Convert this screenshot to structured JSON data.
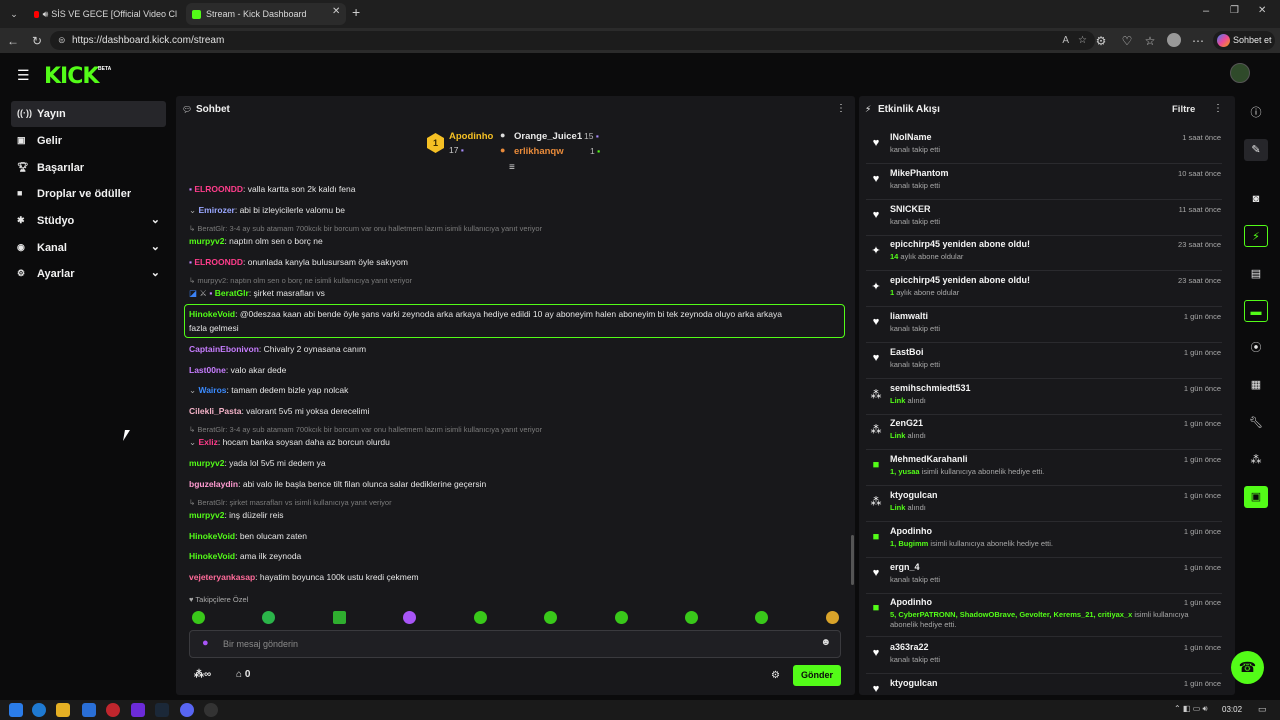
{
  "browser": {
    "tabs": [
      {
        "label": "SİS VE GECE [Official Video Cl"
      },
      {
        "label": "Stream - Kick Dashboard"
      }
    ],
    "url": "https://dashboard.kick.com/stream",
    "copilot": "Sohbet et"
  },
  "logo": {
    "text": "KICK",
    "badge": "BETA"
  },
  "sidebar": {
    "items": [
      {
        "label": "Yayın",
        "icon": "broadcast-icon"
      },
      {
        "label": "Gelir",
        "icon": "revenue-icon"
      },
      {
        "label": "Başarılar",
        "icon": "trophy-icon"
      },
      {
        "label": "Droplar ve ödüller",
        "icon": "gift-icon"
      },
      {
        "label": "Stüdyo",
        "icon": "studio-icon"
      },
      {
        "label": "Kanal",
        "icon": "channel-icon"
      },
      {
        "label": "Ayarlar",
        "icon": "gear-icon"
      }
    ]
  },
  "chat": {
    "title": "Sohbet",
    "leaderboard": {
      "first": {
        "rank": "1",
        "name": "Apodinho",
        "count": "17"
      },
      "second": {
        "name": "Orange_Juice1",
        "count": "15"
      },
      "third": {
        "name": "erlikhanqw",
        "count": "1"
      }
    },
    "messages": [
      {
        "user": "ELROONDD",
        "text": ": valla kartta son 2k kaldı fena",
        "color": "#ff3d8b"
      },
      {
        "user": "Emirozer",
        "text": ": abi bi izleyicilerle valomu be",
        "color": "#9aa7ff"
      },
      {
        "reply": "BeratGlr: 3-4 ay sub atamam 700kcık bir borcum var onu halletmem lazım isimli kullanıcıya yanıt veriyor"
      },
      {
        "user": "murpyv2",
        "text": ": naptın olm sen o borç ne",
        "color": "#53fc18"
      },
      {
        "user": "ELROONDD",
        "text": ": onunlada kanyla bulusursam öyle sakıyom",
        "color": "#ff3d8b"
      },
      {
        "reply": "murpyv2: naptın olm sen o borç ne isimli kullanıcıya yanıt veriyor"
      },
      {
        "user": "BeratGlr",
        "text": ": şirket masrafları vs",
        "color": "#53fc18"
      },
      {
        "user": "HinokeVoid",
        "text": ": @0deszaa kaan abi bende öyle şans varki zeynoda arka arkaya hediye edildi 10 ay aboneyim halen aboneyim bi tek zeynoda oluyo arka arkaya",
        "text2": "fazla gelmesi",
        "color": "#53fc18"
      },
      {
        "user": "CaptainEbonivon",
        "text": ": Chivalry 2 oynasana canım",
        "color": "#c77dff"
      },
      {
        "user": "Last00ne",
        "text": ": valo akar dede",
        "color": "#c77dff"
      },
      {
        "user": "Wairos",
        "text": ": tamam dedem bizle yap nolcak",
        "color": "#3b8bff"
      },
      {
        "user": "Cilekli_Pasta",
        "text": ": valorant 5v5 mi yoksa derecelimi",
        "color": "#f5b3c8"
      },
      {
        "reply": "BeratGlr: 3-4 ay sub atamam 700kcık bir borcum var onu halletmem lazım isimli kullanıcıya yanıt veriyor"
      },
      {
        "user": "Exliz",
        "text": ": hocam banka soysan daha az borcun olurdu",
        "color": "#ff3d8b"
      },
      {
        "user": "murpyv2",
        "text": ": yada lol 5v5 mi dedem ya",
        "color": "#53fc18"
      },
      {
        "user": "bguzelaydin",
        "text": ": abi valo ile başla bence tilt filan olunca salar dediklerine geçersin",
        "color": "#ff9bd1"
      },
      {
        "reply": "BeratGlr: şirket masrafları vs isimli kullanıcıya yanıt veriyor"
      },
      {
        "user": "murpyv2",
        "text": ": inş düzelir reis",
        "color": "#53fc18"
      },
      {
        "user": "HinokeVoid",
        "text": ": ben olucam zaten",
        "color": "#53fc18"
      },
      {
        "user": "HinokeVoid",
        "text": ": ama ilk zeynoda",
        "color": "#53fc18"
      },
      {
        "user": "vejeteryankasap",
        "text": ": hayatim boyunca 100k ustu kredi çekmem",
        "color": "#ff6b9a"
      }
    ],
    "emote_tab": "Takipçilere Özel",
    "input_placeholder": "Bir mesaj gönderin",
    "points": "∞",
    "shop_count": "0",
    "send": "Gönder"
  },
  "activity": {
    "title": "Etkinlik Akışı",
    "filter": "Filtre",
    "events": [
      {
        "name": "INolName",
        "desc": "kanalı takip etti",
        "time": "1 saat önce",
        "icon": "heart-icon"
      },
      {
        "name": "MikePhantom",
        "desc": "kanalı takip etti",
        "time": "10 saat önce",
        "icon": "heart-icon"
      },
      {
        "name": "SNICKER",
        "desc": "kanalı takip etti",
        "time": "11 saat önce",
        "icon": "heart-icon"
      },
      {
        "name": "epicchirp45 yeniden abone oldu!",
        "hl": "14",
        "desc": " aylık abone oldular",
        "time": "23 saat önce",
        "icon": "sparkle-icon"
      },
      {
        "name": "epicchirp45 yeniden abone oldu!",
        "hl": "1",
        "desc": " aylık abone oldular",
        "time": "23 saat önce",
        "icon": "sparkle-icon"
      },
      {
        "name": "liamwalti",
        "desc": "kanalı takip etti",
        "time": "1 gün önce",
        "icon": "heart-icon"
      },
      {
        "name": "EastBoi",
        "desc": "kanalı takip etti",
        "time": "1 gün önce",
        "icon": "heart-icon"
      },
      {
        "name": "semihschmiedt531",
        "hl": "Link",
        "desc": " alındı",
        "time": "1 gün önce",
        "icon": "channel-points-icon"
      },
      {
        "name": "ZenG21",
        "hl": "Link",
        "desc": " alındı",
        "time": "1 gün önce",
        "icon": "channel-points-icon"
      },
      {
        "name": "MehmedKarahanli",
        "hl": "1, yusaa",
        "desc": " isimli kullanıcıya abonelik hediye etti.",
        "time": "1 gün önce",
        "icon": "gift-icon"
      },
      {
        "name": "ktyogulcan",
        "hl": "Link",
        "desc": " alındı",
        "time": "1 gün önce",
        "icon": "channel-points-icon"
      },
      {
        "name": "Apodinho",
        "hl": "1, Bugimm",
        "desc": " isimli kullanıcıya abonelik hediye etti.",
        "time": "1 gün önce",
        "icon": "gift-icon"
      },
      {
        "name": "ergn_4",
        "desc": "kanalı takip etti",
        "time": "1 gün önce",
        "icon": "heart-icon"
      },
      {
        "name": "Apodinho",
        "hl": "5, CyberPATRONN, ShadowOBrave, Gevolter, Kerems_21, critiyax_x",
        "desc": " isimli kullanıcıya",
        "desc2": "abonelik hediye etti.",
        "time": "1 gün önce",
        "icon": "gift-icon"
      },
      {
        "name": "a363ra22",
        "desc": "kanalı takip etti",
        "time": "1 gün önce",
        "icon": "heart-icon"
      },
      {
        "name": "ktyogulcan",
        "desc": "",
        "time": "1 gün önce",
        "icon": "heart-icon"
      }
    ]
  },
  "taskbar": {
    "time": "03:02"
  },
  "colors": {
    "accent": "#53fc18",
    "panel": "#18181b",
    "bg": "#0b0b0c"
  }
}
